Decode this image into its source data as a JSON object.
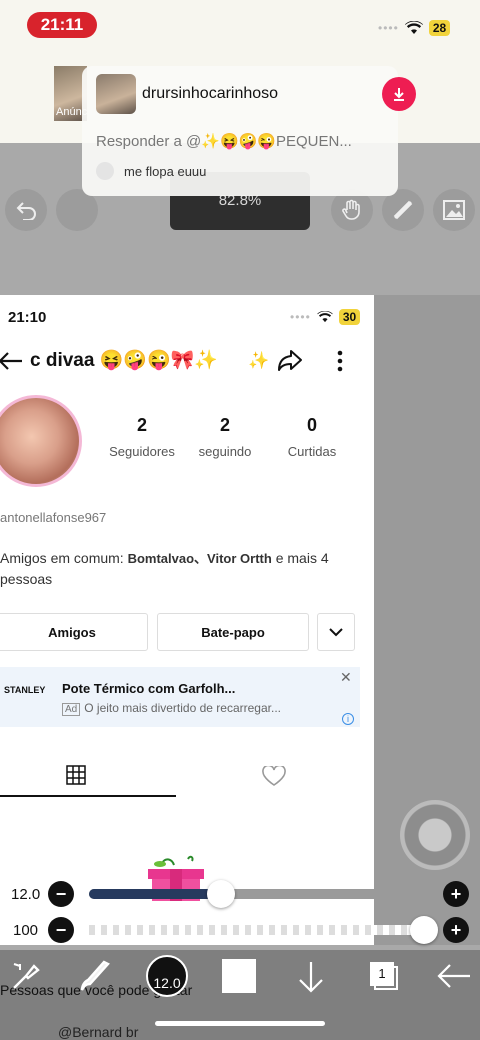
{
  "status": {
    "time": "21:11",
    "battery": "28"
  },
  "notification": {
    "ad_label": "Anúncios",
    "username": "drursinhocarinhoso",
    "reply": "Responder a @✨😝🤪😜PEQUEN...",
    "me_text": "me  flopa euuu"
  },
  "editor": {
    "zoom": "82.8%",
    "brush_size_label": "12.0",
    "opacity_label": "100",
    "brush_value": "12.0",
    "layer_count": "1",
    "brush_level": 0.39,
    "opacity_level": 1.0
  },
  "profile": {
    "time": "21:10",
    "battery": "30",
    "name": "c divaa 😝🤪😜🎀✨",
    "extra_icon": "✨",
    "stats": [
      {
        "n": "2",
        "l": "Seguidores"
      },
      {
        "n": "2",
        "l": "seguindo"
      },
      {
        "n": "0",
        "l": "Curtidas"
      }
    ],
    "username": "antonellafonse967",
    "mutual_prefix": "Amigos em comum: ",
    "mutual_names": "Bomtalvao、Vitor Ortth",
    "mutual_suffix": " e mais 4 pessoas",
    "buttons": {
      "friends": "Amigos",
      "chat": "Bate-papo"
    },
    "ad": {
      "brand": "STANLEY",
      "title": "Pote Térmico com Garfolh...",
      "tag": "Ad",
      "sub": "O jeito  mais divertido  de recarregar..."
    },
    "suggest": "Pessoas que você pode gostar",
    "suggest_user": "@Bernard br"
  },
  "colors": {
    "accent": "#ee1d52",
    "clock": "#d8232c",
    "slider_fill": "#263a5e"
  }
}
